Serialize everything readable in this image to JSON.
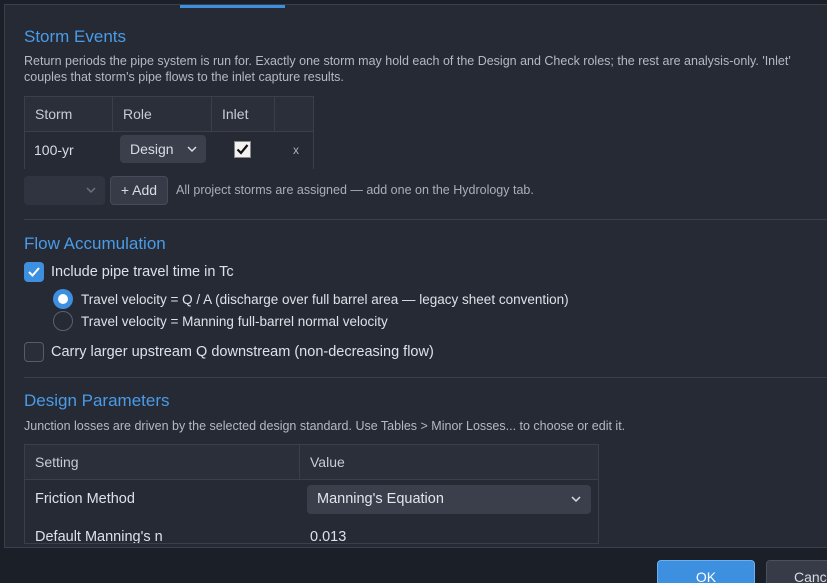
{
  "storm_events": {
    "title": "Storm Events",
    "description_line1": "Return periods the pipe system is run for. Exactly one storm may hold each of the Design and Check roles; the rest are analysis-only. 'Inlet'",
    "description_line2": "couples that storm's pipe flows to the inlet capture results.",
    "columns": [
      "Storm",
      "Role",
      "Inlet"
    ],
    "rows": [
      {
        "storm": "100-yr",
        "role": "Design",
        "inlet_checked": true,
        "remove_label": "x"
      }
    ],
    "add_label": "+ Add",
    "add_note": "All project storms are assigned — add one on the Hydrology tab."
  },
  "flow_accumulation": {
    "title": "Flow Accumulation",
    "include_travel_time_label": "Include pipe travel time in Tc",
    "include_travel_time_checked": true,
    "velocity_options": [
      {
        "label": "Travel velocity = Q / A (discharge over full barrel area — legacy sheet convention)",
        "selected": true
      },
      {
        "label": "Travel velocity = Manning full-barrel normal velocity",
        "selected": false
      }
    ],
    "carry_upstream_label": "Carry larger upstream Q downstream (non-decreasing flow)",
    "carry_upstream_checked": false
  },
  "design_parameters": {
    "title": "Design Parameters",
    "description": "Junction losses are driven by the selected design standard. Use Tables > Minor Losses... to choose or edit it.",
    "columns": [
      "Setting",
      "Value"
    ],
    "rows": [
      {
        "setting": "Friction Method",
        "value": "Manning's Equation"
      },
      {
        "setting": "Default Manning's n",
        "value": "0.013"
      }
    ]
  },
  "footer": {
    "ok_label": "OK",
    "cancel_label": "Cancel"
  },
  "colors": {
    "accent": "#3d8fe0",
    "background": "#262a34"
  }
}
